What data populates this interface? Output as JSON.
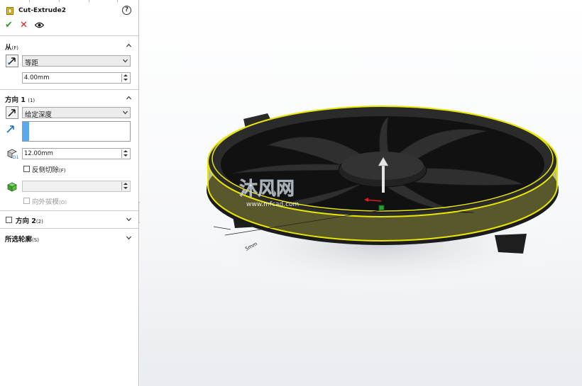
{
  "feature": {
    "title": "Cut-Extrude2",
    "help_icon": "question-circle-icon"
  },
  "actions": {
    "ok": "✔",
    "cancel": "✕",
    "preview_icon": "eye-icon"
  },
  "from_section": {
    "title": "从",
    "key": "(F)",
    "start_condition": "等距",
    "offset_value": "4.00mm"
  },
  "direction1": {
    "title": "方向 1",
    "key": "(1)",
    "end_condition": "给定深度",
    "depth": "12.00mm",
    "flip_label": "反侧切除",
    "flip_key": "(F)",
    "draft_label": "向外拔模",
    "draft_key": "(O)"
  },
  "direction2": {
    "title": "方向 2",
    "key": "(2)"
  },
  "selected_contours": {
    "title": "所选轮廓",
    "key": "(S)"
  },
  "watermark": {
    "brand": "沐风网",
    "url": "www.mfcad.com"
  },
  "dimension_label": "5mm",
  "colors": {
    "accent_blue": "#5aa9ef",
    "ok_green": "#2e9e2e",
    "cancel_red": "#d42020",
    "highlight_yellow": "#e8e600"
  }
}
